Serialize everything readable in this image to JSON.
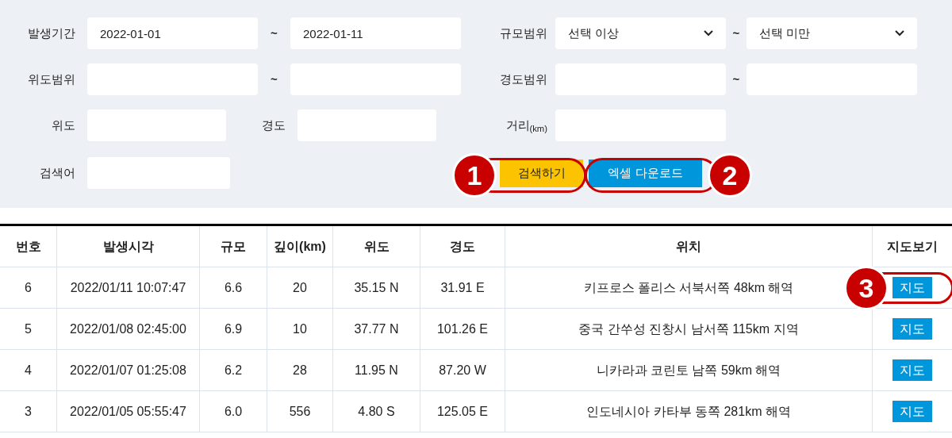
{
  "search_form": {
    "period": {
      "label": "발생기간",
      "from": "2022-01-01",
      "to": "2022-01-11",
      "separator": "~"
    },
    "magnitude": {
      "label": "규모범위",
      "from": "선택 이상",
      "to": "선택 미만",
      "separator": "~"
    },
    "lat_range": {
      "label": "위도범위",
      "separator": "~"
    },
    "lon_range": {
      "label": "경도범위",
      "separator": "~"
    },
    "lat": {
      "label": "위도"
    },
    "lon": {
      "label": "경도"
    },
    "distance": {
      "label": "거리$_{(km)}$"
    },
    "keyword": {
      "label": "검색어"
    },
    "buttons": [
      {
        "kind": "search",
        "label": "검색하기",
        "callout": "1"
      },
      {
        "kind": "excel",
        "label": "엑셀 다운로드",
        "callout": "2"
      }
    ]
  },
  "table": {
    "columns": [
      "번호",
      "발생시각",
      "규모",
      "깊이(km)",
      "위도",
      "경도",
      "위치",
      "지도보기"
    ],
    "rows": [
      {
        "cells": [
          "6",
          "2022/01/11 10:07:47",
          "6.6",
          "20",
          "35.15 N",
          "31.91 E",
          "키프로스 폴리스 서북서쪽 48km 해역"
        ],
        "map_button": "지도",
        "callout": "3"
      },
      {
        "cells": [
          "5",
          "2022/01/08 02:45:00",
          "6.9",
          "10",
          "37.77 N",
          "101.26 E",
          "중국 간쑤성 진창시 남서쪽 115km 지역"
        ],
        "map_button": "지도"
      },
      {
        "cells": [
          "4",
          "2022/01/07 01:25:08",
          "6.2",
          "28",
          "11.95 N",
          "87.20 W",
          "니카라과 코린토 남쪽 59km 해역"
        ],
        "map_button": "지도"
      },
      {
        "cells": [
          "3",
          "2022/01/05 05:55:47",
          "6.0",
          "556",
          "4.80 S",
          "125.05 E",
          "인도네시아 카타부 동쪽 281km 해역"
        ],
        "map_button": "지도"
      }
    ]
  }
}
